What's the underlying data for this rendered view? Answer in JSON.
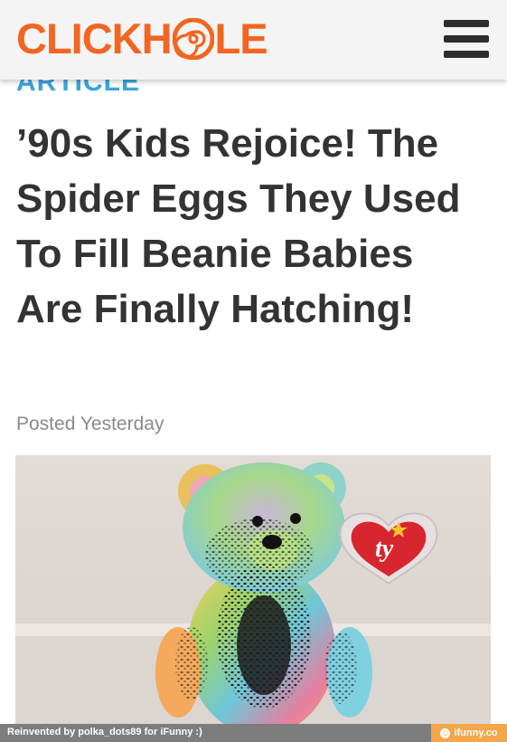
{
  "header": {
    "logo_prefix": "CLICKH",
    "logo_suffix": "LE",
    "logo_alt": "CLICKHOLE"
  },
  "article": {
    "section": "ARTICLE",
    "headline": "’90s Kids Rejoice! The Spider Eggs They Used To Fill Beanie Babies Are Finally Hatching!",
    "posted": "Posted Yesterday",
    "tag_text": "ty"
  },
  "footer": {
    "credit": "Reinvented by polka_dots89 for iFunny :)",
    "brand": "ifunny.co"
  },
  "colors": {
    "brand_orange": "#f26522",
    "section_blue": "#3aa6dd",
    "headline": "#333333",
    "tag_red": "#d8262e"
  }
}
